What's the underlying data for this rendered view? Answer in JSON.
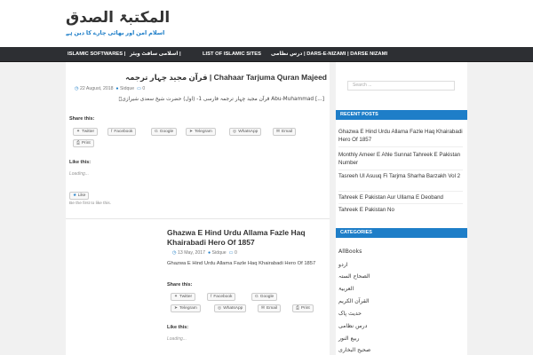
{
  "site": {
    "title": "المکتبۃ الصدق",
    "tagline": "اسلام امن اور بھائی چارے کا دین ہے"
  },
  "nav": {
    "items": [
      "ISLAMIC SOFTWARES |",
      "اسلامی سافٹ ویئر |",
      "LIST OF ISLAMIC SITES",
      "درس نظامی | DARS-E-NIZAMI | DARSE NIZAMI"
    ]
  },
  "posts": [
    {
      "title": "قرآن مجید چہار ترجمہ | Chahaar Tarjuma Quran Majeed",
      "date": "22 August, 2018",
      "author": "Sidque",
      "comments": "0",
      "excerpt": "قرآن مجید چہار ترجمہ فارسی 1- (اول) حضرت شیخ سعدی شیرازیؒ Abu-Muhammad [...]",
      "share_label": "Share this:",
      "share_buttons": [
        "Twitter",
        "Facebook",
        "Google",
        "Telegram",
        "WhatsApp",
        "Email",
        "Print"
      ],
      "like_label": "Like this:",
      "loading": "Loading...",
      "like_button": "Like",
      "like_note": "Be the first to like this."
    },
    {
      "title": "Ghazwa E Hind Urdu Allama Fazle Haq Khairabadi Hero Of 1857",
      "date": "13 May, 2017",
      "author": "Sidque",
      "comments": "0",
      "excerpt": "Ghazwa E Hind Urdu Allama Fazle Haq Khairabadi Hero Of 1857",
      "share_label": "Share this:",
      "share_buttons": [
        "Twitter",
        "Facebook",
        "Google",
        "Telegram",
        "WhatsApp",
        "Email",
        "Print"
      ],
      "like_label": "Like this:",
      "loading": "Loading..."
    }
  ],
  "sidebar": {
    "search_placeholder": "Search ...",
    "recent_heading": "RECENT POSTS",
    "recent_posts": [
      "Ghazwa E Hind Urdu Allama Fazle Haq Khairabadi Hero Of 1857",
      "Monthly Ameer E Ahle Sunnat Tahreek E Pakistan Number",
      "Tasreeh Ul Asuuq Fi Tarjma Sharha Barzakh Vol 2",
      "Tahreek E Pakistan Aur Ullama E Deoband",
      "Tahreek E Pakistan No"
    ],
    "categories_heading": "CATEGORIES",
    "categories": [
      "AllBooks",
      "اردو",
      "الصحاح الستہ",
      "العربیۃ",
      "القرآن الکریم",
      "حدیث پاک",
      "درس نظامی",
      "ربیع النور",
      "صحیح البخاری"
    ]
  }
}
